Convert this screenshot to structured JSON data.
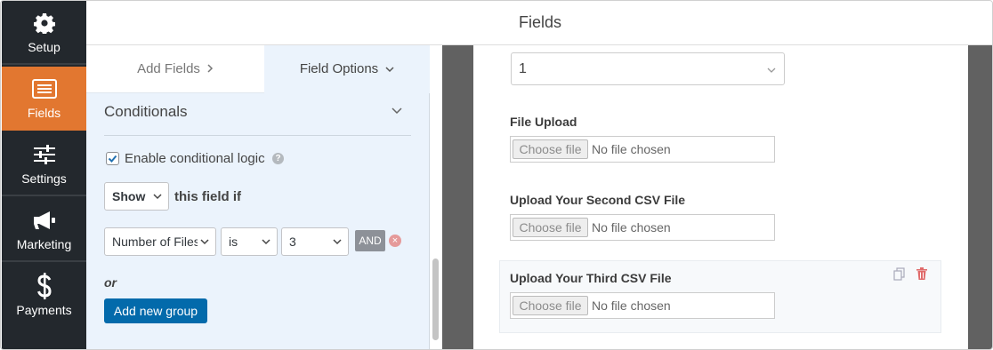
{
  "nav": {
    "items": [
      {
        "label": "Setup",
        "icon": "gear-icon"
      },
      {
        "label": "Fields",
        "icon": "list-icon",
        "active": true
      },
      {
        "label": "Settings",
        "icon": "sliders-icon"
      },
      {
        "label": "Marketing",
        "icon": "megaphone-icon"
      },
      {
        "label": "Payments",
        "icon": "dollar-icon"
      }
    ]
  },
  "header": {
    "title": "Fields"
  },
  "options": {
    "tabs": {
      "add_fields": "Add Fields",
      "field_options": "Field Options"
    },
    "section_title": "Conditionals",
    "enable_label": "Enable conditional logic",
    "enable_checked": true,
    "action": {
      "selected": "Show",
      "suffix": "this field if"
    },
    "rule": {
      "field": "Number of Files",
      "operator": "is",
      "value": "3",
      "and_label": "AND"
    },
    "or_label": "or",
    "add_group_label": "Add new group"
  },
  "preview": {
    "top_select_value": "1",
    "fields": [
      {
        "label": "File Upload",
        "button": "Choose file",
        "status": "No file chosen"
      },
      {
        "label": "Upload Your Second CSV File",
        "button": "Choose file",
        "status": "No file chosen"
      },
      {
        "label": "Upload Your Third CSV File",
        "button": "Choose file",
        "status": "No file chosen"
      }
    ]
  },
  "colors": {
    "nav_bg": "#23282d",
    "nav_active": "#e27730",
    "panel_bg": "#ebf3fc",
    "primary_button": "#036aab",
    "preview_bg": "#616161"
  }
}
